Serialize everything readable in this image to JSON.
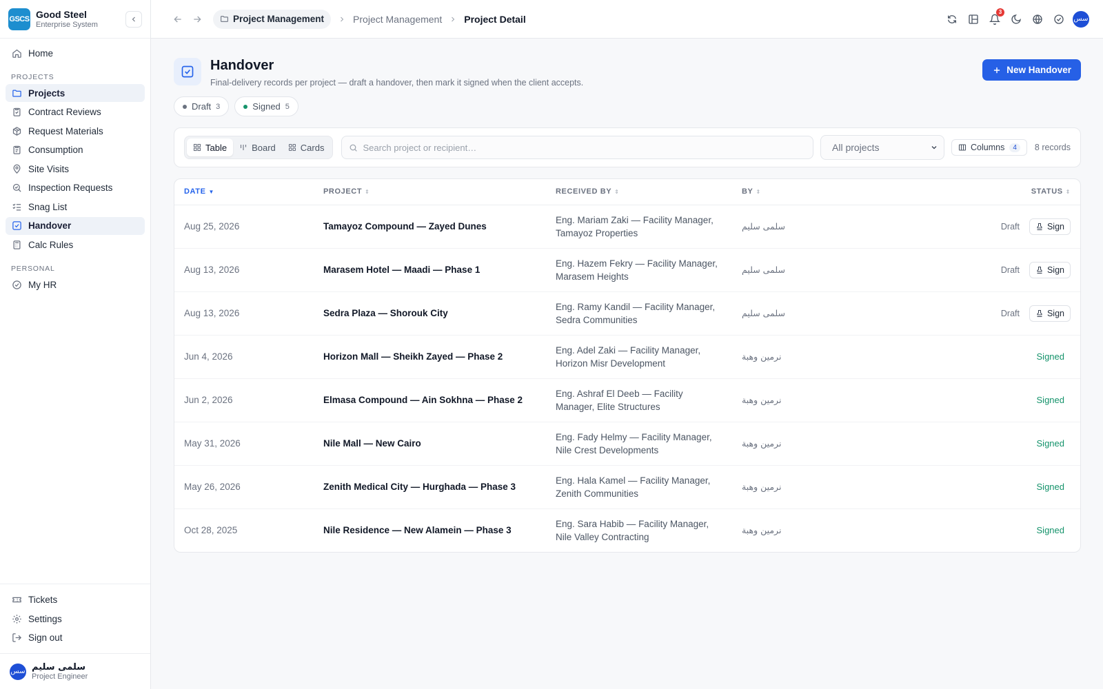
{
  "brand": {
    "logo": "GSCS",
    "name": "Good Steel",
    "subtitle": "Enterprise System"
  },
  "sidebar": {
    "home": "Home",
    "projects_section": "PROJECTS",
    "items": [
      {
        "label": "Projects",
        "icon": "folder-icon"
      },
      {
        "label": "Contract Reviews",
        "icon": "clipboard-check-icon"
      },
      {
        "label": "Request Materials",
        "icon": "package-icon"
      },
      {
        "label": "Consumption",
        "icon": "clipboard-icon"
      },
      {
        "label": "Site Visits",
        "icon": "map-pin-icon"
      },
      {
        "label": "Inspection Requests",
        "icon": "search-check-icon"
      },
      {
        "label": "Snag List",
        "icon": "list-checks-icon"
      },
      {
        "label": "Handover",
        "icon": "square-check-icon"
      },
      {
        "label": "Calc Rules",
        "icon": "calculator-icon"
      }
    ],
    "personal_section": "PERSONAL",
    "my_hr": "My HR",
    "bottom": {
      "tickets": "Tickets",
      "settings": "Settings",
      "signout": "Sign out"
    },
    "user": {
      "initials": "سس",
      "name": "سلمى سليم",
      "role": "Project Engineer"
    }
  },
  "topbar": {
    "crumb_module": "Project Management",
    "crumb_parent": "Project Management",
    "crumb_current": "Project Detail",
    "notifications_count": "3",
    "avatar_initials": "سس"
  },
  "page": {
    "title": "Handover",
    "subtitle": "Final-delivery records per project — draft a handover, then mark it signed when the client accepts.",
    "new_button": "New Handover"
  },
  "chips": [
    {
      "label": "Draft",
      "count": "3",
      "color": "#6b7280"
    },
    {
      "label": "Signed",
      "count": "5",
      "color": "#15936b"
    }
  ],
  "toolbar": {
    "views": [
      "Table",
      "Board",
      "Cards"
    ],
    "active_view": "Table",
    "search_placeholder": "Search project or recipient…",
    "project_filter": "All projects",
    "columns_label": "Columns",
    "columns_count": "4",
    "records": "8 records"
  },
  "table": {
    "headers": {
      "date": "DATE",
      "project": "PROJECT",
      "received_by": "RECEIVED BY",
      "by": "BY",
      "status": "STATUS"
    },
    "sign_label": "Sign",
    "rows": [
      {
        "date": "Aug 25, 2026",
        "project": "Tamayoz Compound — Zayed Dunes",
        "received_by": "Eng. Mariam Zaki — Facility Manager, Tamayoz Properties",
        "by": "سلمى سليم",
        "status": "Draft"
      },
      {
        "date": "Aug 13, 2026",
        "project": "Marasem Hotel — Maadi — Phase 1",
        "received_by": "Eng. Hazem Fekry — Facility Manager, Marasem Heights",
        "by": "سلمى سليم",
        "status": "Draft"
      },
      {
        "date": "Aug 13, 2026",
        "project": "Sedra Plaza — Shorouk City",
        "received_by": "Eng. Ramy Kandil — Facility Manager, Sedra Communities",
        "by": "سلمى سليم",
        "status": "Draft"
      },
      {
        "date": "Jun 4, 2026",
        "project": "Horizon Mall — Sheikh Zayed — Phase 2",
        "received_by": "Eng. Adel Zaki — Facility Manager, Horizon Misr Development",
        "by": "نرمين وهبة",
        "status": "Signed"
      },
      {
        "date": "Jun 2, 2026",
        "project": "Elmasa Compound — Ain Sokhna — Phase 2",
        "received_by": "Eng. Ashraf El Deeb — Facility Manager, Elite Structures",
        "by": "نرمين وهبة",
        "status": "Signed"
      },
      {
        "date": "May 31, 2026",
        "project": "Nile Mall — New Cairo",
        "received_by": "Eng. Fady Helmy — Facility Manager, Nile Crest Developments",
        "by": "نرمين وهبة",
        "status": "Signed"
      },
      {
        "date": "May 26, 2026",
        "project": "Zenith Medical City — Hurghada — Phase 3",
        "received_by": "Eng. Hala Kamel — Facility Manager, Zenith Communities",
        "by": "نرمين وهبة",
        "status": "Signed"
      },
      {
        "date": "Oct 28, 2025",
        "project": "Nile Residence — New Alamein — Phase 3",
        "received_by": "Eng. Sara Habib — Facility Manager, Nile Valley Contracting",
        "by": "نرمين وهبة",
        "status": "Signed"
      }
    ]
  },
  "colors": {
    "accent": "#2660e6",
    "signed": "#15936b",
    "logo": "#1d8ecf"
  }
}
